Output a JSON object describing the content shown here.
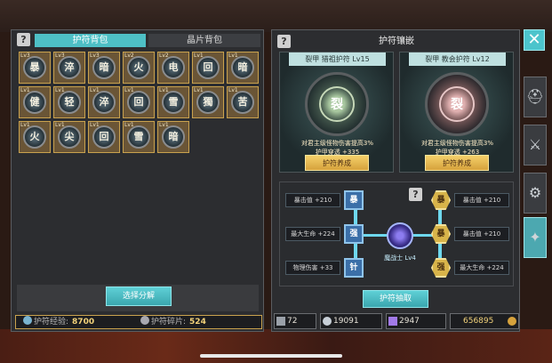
{
  "left_panel": {
    "tabs": [
      "护符背包",
      "晶片背包"
    ],
    "grid": [
      {
        "lvl": "Lv3",
        "ch": "暴"
      },
      {
        "lvl": "Lv3",
        "ch": "淬"
      },
      {
        "lvl": "Lv3",
        "ch": "暗"
      },
      {
        "lvl": "Lv2",
        "ch": "火"
      },
      {
        "lvl": "Lv2",
        "ch": "电"
      },
      {
        "lvl": "Lv1",
        "ch": "回"
      },
      {
        "lvl": "Lv1",
        "ch": "暗"
      },
      {
        "lvl": "Lv1",
        "ch": "健"
      },
      {
        "lvl": "Lv1",
        "ch": "轻"
      },
      {
        "lvl": "Lv1",
        "ch": "淬"
      },
      {
        "lvl": "Lv1",
        "ch": "回"
      },
      {
        "lvl": "Lv1",
        "ch": "雪"
      },
      {
        "lvl": "Lv1",
        "ch": "獨"
      },
      {
        "lvl": "Lv1",
        "ch": "苦"
      },
      {
        "lvl": "Lv1",
        "ch": "火"
      },
      {
        "lvl": "Lv1",
        "ch": "尖"
      },
      {
        "lvl": "Lv1",
        "ch": "回"
      },
      {
        "lvl": "Lv1",
        "ch": "雪"
      },
      {
        "lvl": "Lv1",
        "ch": "暗"
      }
    ],
    "decompose_label": "选择分解",
    "stats": {
      "exp_label": "护符经验:",
      "exp_value": "8700",
      "shard_label": "护符碎片:",
      "shard_value": "524"
    }
  },
  "right_panel": {
    "title": "护符镶嵌",
    "cards": [
      {
        "header": "裂甲 猎祖护符 Lv15",
        "glyph": "裂",
        "d1": "对君主级怪物伤害提高3%",
        "d2": "护甲穿透 +335",
        "button": "护符养成"
      },
      {
        "header": "裂甲 教会护符 Lv12",
        "glyph": "裂",
        "d1": "对君主级怪物伤害提高3%",
        "d2": "护甲穿透 +263",
        "button": "护符养成"
      }
    ],
    "socket": {
      "left_labels": [
        "暴击值 +210",
        "最大生命 +224",
        "物理伤害 +33"
      ],
      "left_gems": [
        "暴",
        "强",
        "针"
      ],
      "right_labels": [
        "暴击值 +210",
        "暴击值 +210",
        "最大生命 +224"
      ],
      "right_gems": [
        "暴",
        "暴",
        "强"
      ],
      "center_label": "魔战士 Lv4"
    },
    "extract_label": "护符抽取"
  },
  "resources": [
    "72",
    "19091",
    "2947",
    "656895"
  ],
  "colors": {
    "accent": "#4ec0c6",
    "gold": "#c9a24e"
  },
  "icons": [
    "help-icon",
    "close-icon",
    "helmet-icon",
    "swords-icon",
    "gear-icon",
    "compass-icon"
  ]
}
